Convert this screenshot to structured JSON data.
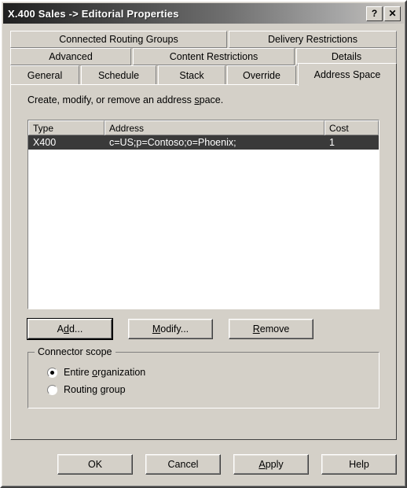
{
  "window": {
    "title": "X.400 Sales -> Editorial Properties",
    "help_button": "?",
    "close_button": "✕"
  },
  "tabs": {
    "row1": [
      {
        "label": "Connected Routing Groups",
        "selected": false
      },
      {
        "label": "Delivery Restrictions",
        "selected": false
      }
    ],
    "row2": [
      {
        "label": "Advanced",
        "selected": false
      },
      {
        "label": "Content Restrictions",
        "selected": false
      },
      {
        "label": "Details",
        "selected": false
      }
    ],
    "row3": [
      {
        "label": "General",
        "selected": false
      },
      {
        "label": "Schedule",
        "selected": false
      },
      {
        "label": "Stack",
        "selected": false
      },
      {
        "label": "Override",
        "selected": false
      },
      {
        "label": "Address Space",
        "selected": true
      }
    ]
  },
  "page": {
    "instruction_before": "Create, modify, or remove an address ",
    "instruction_mnemonic": "s",
    "instruction_after": "pace.",
    "listview": {
      "columns": [
        "Type",
        "Address",
        "Cost"
      ],
      "rows": [
        {
          "type": "X400",
          "address": "c=US;p=Contoso;o=Phoenix;",
          "cost": "1",
          "selected": true
        }
      ]
    },
    "actions": {
      "add": {
        "before": "A",
        "mnemonic": "d",
        "after": "d..."
      },
      "modify": {
        "before": "",
        "mnemonic": "M",
        "after": "odify..."
      },
      "remove": {
        "before": "",
        "mnemonic": "R",
        "after": "emove"
      }
    },
    "connector_scope": {
      "legend": "Connector scope",
      "options": [
        {
          "before": "Entire ",
          "mnemonic": "o",
          "after": "rganization",
          "checked": true
        },
        {
          "before": "Routing ",
          "mnemonic": "g",
          "after": "roup",
          "checked": false
        }
      ]
    }
  },
  "footer": {
    "ok": {
      "before": "OK",
      "mnemonic": "",
      "after": ""
    },
    "cancel": {
      "before": "Cancel",
      "mnemonic": "",
      "after": ""
    },
    "apply": {
      "before": "",
      "mnemonic": "A",
      "after": "pply"
    },
    "help": {
      "before": "Help",
      "mnemonic": "",
      "after": ""
    }
  },
  "colors": {
    "face": "#d4d0c8",
    "selection": "#3a3a3a",
    "title_start": "#202020",
    "title_end": "#c8c4be"
  }
}
